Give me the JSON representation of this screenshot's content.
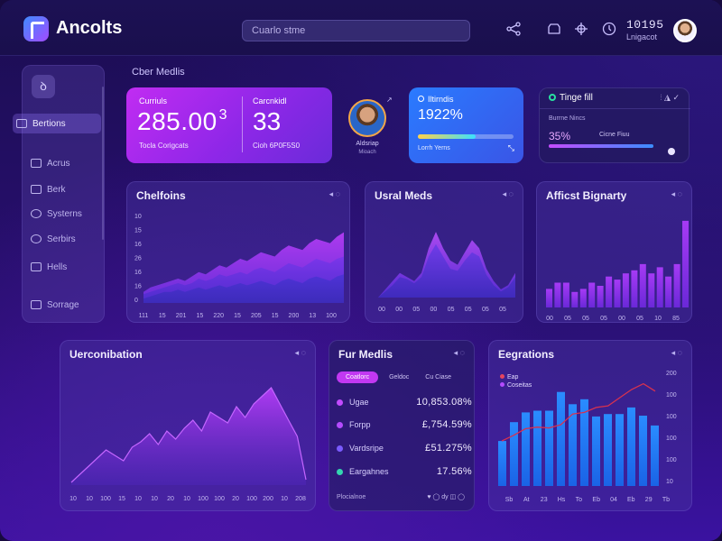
{
  "header": {
    "app_name": "Ancolts",
    "search_placeholder": "Cuarlo stme",
    "user_value": "10195",
    "user_label": "Lnigacot",
    "icons": [
      "share-icon",
      "box-icon",
      "crosshair-icon",
      "clock-icon"
    ]
  },
  "sidebar": {
    "logo_glyph": "ꝺ",
    "items": [
      {
        "label": "Bertions",
        "icon": "book-icon"
      },
      {
        "label": "Acrus",
        "icon": "card-icon"
      },
      {
        "label": "Berk",
        "icon": "grid-icon"
      },
      {
        "label": "Systerns",
        "icon": "chat-icon"
      },
      {
        "label": "Serbirs",
        "icon": "gear-icon"
      },
      {
        "label": "Hells",
        "icon": "stack-icon"
      },
      {
        "label": "Sorrage",
        "icon": "storage-icon"
      }
    ]
  },
  "section_title": "Cber Medlis",
  "kpis": {
    "a_label": "Curriuls",
    "a_value": "285.00",
    "a_suffix": "3",
    "a_sub": "Tocla Corigcats",
    "b_label": "Carcnkidl",
    "b_value": "33",
    "b_sub": "Cioh 6P0F5S0"
  },
  "profile": {
    "name": "Aldsriap",
    "role": "Mioach",
    "link_glyph": "↗"
  },
  "progress_card": {
    "title": "Iltirndis",
    "value": "1922%",
    "progress": 0.6,
    "sub": "Lorrh Yerns",
    "arrow": "⤡",
    "colors": {
      "start": "#ffd24a",
      "end": "#39e0ff"
    }
  },
  "status_card": {
    "title": "Tinge fill",
    "actions": "⫶  ◮  ✓",
    "sub": "Burrne Nincs",
    "percent": "35%",
    "label": "Cicne Fiuu"
  },
  "charts": {
    "chelfoins": {
      "title": "Chelfoins",
      "actions": "◂ ◌",
      "y_ticks": [
        "10",
        "15",
        "16",
        "26",
        "16",
        "16",
        "0"
      ],
      "x_ticks": [
        "111",
        "15",
        "201",
        "15",
        "220",
        "15",
        "205",
        "15",
        "200",
        "13",
        "100"
      ]
    },
    "usral": {
      "title": "Usral Meds",
      "actions": "◂ ◌",
      "x_ticks": [
        "00",
        "00",
        "05",
        "00",
        "05",
        "05",
        "05",
        "05"
      ]
    },
    "afficst": {
      "title": "Afficst Bignarty",
      "actions": "◂ ◌",
      "x_ticks": [
        "00",
        "05",
        "05",
        "05",
        "00",
        "05",
        "10",
        "85"
      ]
    },
    "uerconibation": {
      "title": "Uerconibation",
      "actions": "◂ ◌",
      "x_ticks": [
        "10",
        "10",
        "100",
        "15",
        "10",
        "10",
        "20",
        "10",
        "100",
        "100",
        "20",
        "100",
        "200",
        "10",
        "208"
      ]
    },
    "fur_medlis": {
      "title": "Fur Medlis",
      "actions": "◂ ◌",
      "tabs": [
        "Coatlorc",
        "Geldoc",
        "Cu Ciase"
      ],
      "rows": [
        {
          "name": "Ugae",
          "value": "10,853.08%",
          "color": "#c34bff"
        },
        {
          "name": "Forpp",
          "value": "£,754.59%",
          "color": "#b44bff"
        },
        {
          "name": "Vardsripe",
          "value": "£51.275%",
          "color": "#7a5bff"
        },
        {
          "name": "Eargahnes",
          "value": "17.56%",
          "color": "#34d6b0"
        }
      ],
      "footer": "Plocialnoe",
      "footer_icons": "♥   ◯ dy  ◫   ◯"
    },
    "eegrations": {
      "title": "Eegrations",
      "actions": "◂ ◌",
      "legend": [
        {
          "label": "Eap",
          "color": "#e6455e"
        },
        {
          "label": "Coseitas",
          "color": "#b44bff"
        }
      ],
      "y_ticks": [
        "200",
        "100",
        "100",
        "100",
        "100",
        "10"
      ],
      "x_ticks": [
        "Sb",
        "At",
        "23",
        "Hs",
        "To",
        "Eb",
        "04",
        "Eb",
        "29",
        "Tb"
      ]
    }
  },
  "chart_data": [
    {
      "type": "area",
      "title": "Chelfoins",
      "x": [
        0,
        1,
        2,
        3,
        4,
        5,
        6,
        7,
        8,
        9,
        10,
        11,
        12,
        13,
        14,
        15,
        16,
        17,
        18,
        19,
        20,
        21,
        22,
        23,
        24,
        25,
        26,
        27,
        28,
        29
      ],
      "series": [
        {
          "values": [
            5,
            7,
            8,
            9,
            10,
            11,
            10,
            12,
            14,
            13,
            15,
            17,
            16,
            18,
            20,
            19,
            21,
            23,
            22,
            21,
            24,
            26,
            25,
            24,
            27,
            29,
            28,
            27,
            30,
            32
          ]
        },
        {
          "values": [
            4,
            5,
            6,
            7,
            8,
            9,
            8,
            9,
            11,
            10,
            11,
            13,
            12,
            13,
            14,
            13,
            15,
            16,
            15,
            14,
            16,
            18,
            17,
            16,
            18,
            20,
            19,
            18,
            20,
            21
          ]
        },
        {
          "values": [
            2,
            3,
            4,
            5,
            5,
            6,
            5,
            6,
            7,
            6,
            7,
            8,
            7,
            8,
            9,
            8,
            9,
            10,
            9,
            8,
            10,
            11,
            10,
            9,
            11,
            12,
            11,
            10,
            12,
            13
          ]
        }
      ],
      "ylim": [
        0,
        40
      ]
    },
    {
      "type": "area",
      "title": "Usral Meds",
      "x": [
        0,
        1,
        2,
        3,
        4,
        5,
        6,
        7,
        8,
        9,
        10,
        11,
        12,
        13,
        14,
        15,
        16,
        17,
        18,
        19
      ],
      "series": [
        {
          "values": [
            0,
            4,
            8,
            12,
            10,
            8,
            12,
            24,
            32,
            24,
            18,
            16,
            22,
            28,
            24,
            14,
            8,
            4,
            6,
            12
          ]
        },
        {
          "values": [
            0,
            3,
            6,
            10,
            9,
            7,
            10,
            20,
            26,
            20,
            14,
            13,
            18,
            22,
            20,
            11,
            6,
            3,
            5,
            10
          ]
        }
      ],
      "ylim": [
        0,
        36
      ]
    },
    {
      "type": "bar",
      "title": "Afficst Bignarty",
      "values": [
        6,
        8,
        8,
        5,
        6,
        8,
        7,
        10,
        9,
        11,
        12,
        14,
        11,
        13,
        10,
        14,
        28
      ],
      "ylim": [
        0,
        30
      ]
    },
    {
      "type": "area",
      "title": "Uerconibation",
      "x": [
        0,
        1,
        2,
        3,
        4,
        5,
        6,
        7,
        8,
        9,
        10,
        11,
        12,
        13,
        14,
        15,
        16,
        17,
        18,
        19,
        20,
        21,
        22,
        23,
        24,
        25,
        26,
        27
      ],
      "series": [
        {
          "values": [
            1,
            4,
            7,
            10,
            13,
            11,
            9,
            14,
            16,
            19,
            15,
            20,
            17,
            21,
            24,
            20,
            27,
            25,
            23,
            29,
            25,
            30,
            33,
            36,
            30,
            24,
            18,
            2
          ]
        }
      ],
      "ylim": [
        0,
        40
      ]
    },
    {
      "type": "bar",
      "title": "Eegrations",
      "values": [
        55,
        78,
        90,
        92,
        92,
        115,
        100,
        106,
        85,
        88,
        88,
        96,
        86,
        74
      ],
      "line": [
        55,
        62,
        70,
        72,
        71,
        75,
        88,
        90,
        96,
        98,
        108,
        118,
        125,
        116
      ],
      "ylim": [
        0,
        140
      ]
    }
  ],
  "theme": {
    "accent": "#c12cf2",
    "blue": "#2a7bff",
    "area_top": "#a933f5",
    "area_mid": "#7a2ee6",
    "area_low": "#4e2fd0",
    "bar_purple": "#8b2df0",
    "bar_blue": "#1f8bff",
    "line_red": "#d8324f"
  }
}
